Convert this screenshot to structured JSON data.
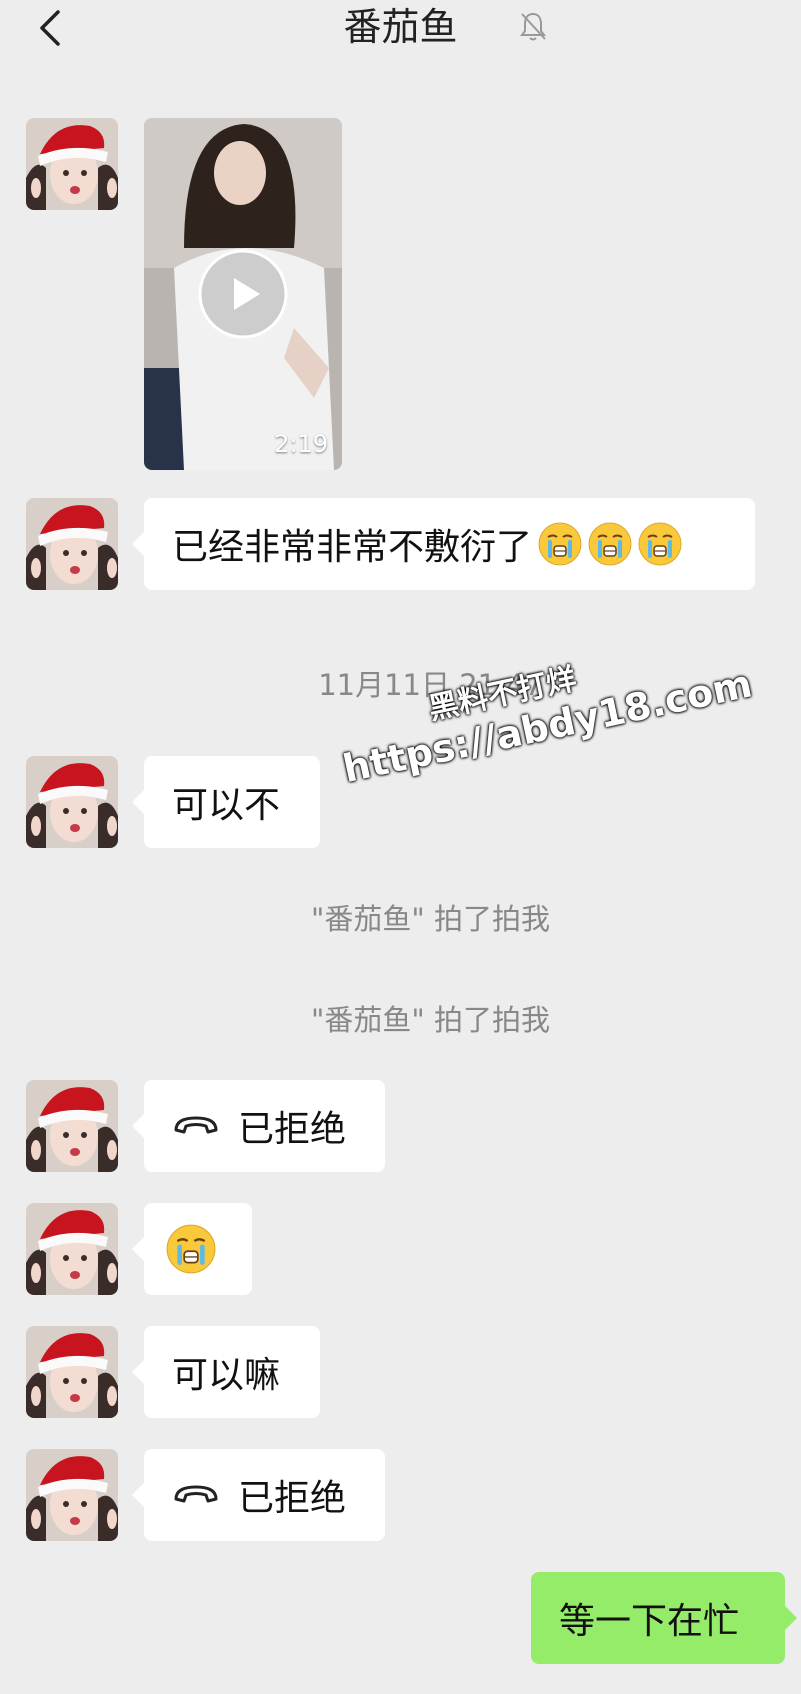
{
  "header": {
    "title": "番茄鱼",
    "back_icon": "chevron-left-icon",
    "mute_icon": "bell-off-icon"
  },
  "contact": {
    "avatar_icon": "avatar-santa-hat"
  },
  "video": {
    "duration": "2:19",
    "play_icon": "play-icon"
  },
  "messages": [
    {
      "text": "已经非常非常不敷衍了",
      "emoji": "crying-face-icon"
    },
    {
      "text": "可以不"
    },
    {
      "text": "已拒绝",
      "icon": "hang-up-phone-icon"
    },
    {
      "emoji": "crying-face-icon"
    },
    {
      "text": "可以嘛"
    },
    {
      "text": "已拒绝",
      "icon": "hang-up-phone-icon"
    },
    {
      "text": "等一下在忙",
      "self": true
    }
  ],
  "timestamp": "11月11日 21:47",
  "pat_notices": [
    "\"番茄鱼\" 拍了拍我",
    "\"番茄鱼\" 拍了拍我"
  ],
  "watermark": {
    "line1": "黑料不打烊",
    "line2": "https://abdy18.com"
  },
  "colors": {
    "background": "#ededed",
    "bubble_self": "#95ec69",
    "bubble_other": "#ffffff",
    "system_text": "#888888"
  }
}
